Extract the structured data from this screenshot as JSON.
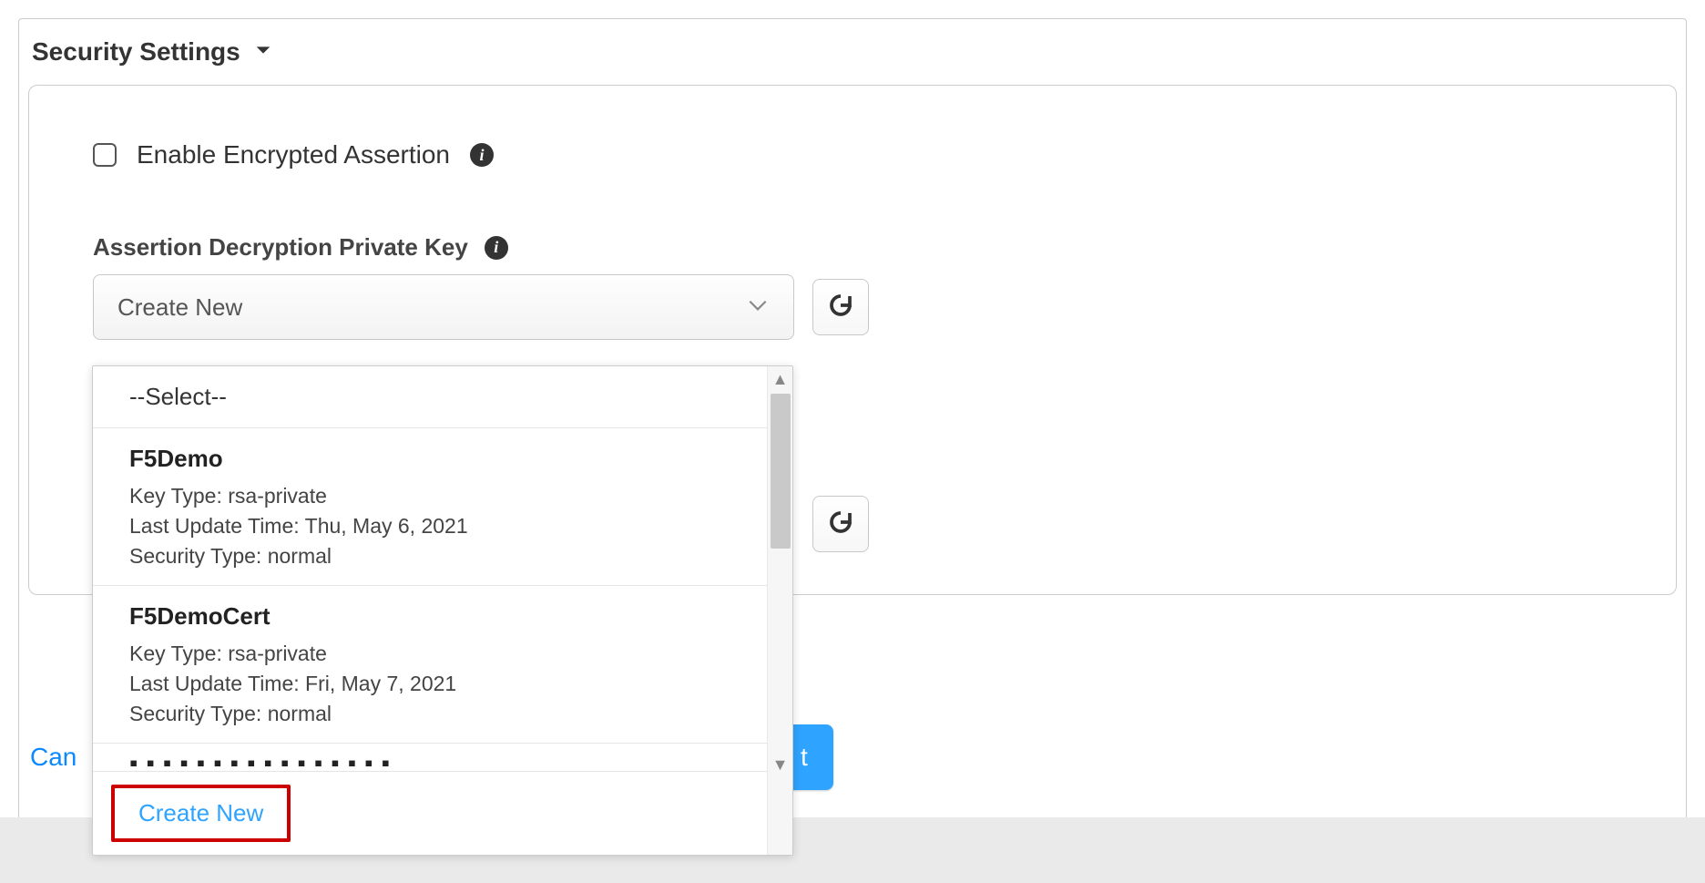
{
  "section": {
    "title": "Security Settings"
  },
  "checkbox": {
    "label": "Enable Encrypted Assertion"
  },
  "field": {
    "label": "Assertion Decryption Private Key"
  },
  "select": {
    "selected": "Create New"
  },
  "dropdown": {
    "placeholder": "--Select--",
    "items": [
      {
        "name": "F5Demo",
        "key_type_label": "Key Type:",
        "key_type": "rsa-private",
        "last_update_label": "Last Update Time:",
        "last_update": "Thu, May 6, 2021",
        "security_type_label": "Security Type:",
        "security_type": "normal"
      },
      {
        "name": "F5DemoCert",
        "key_type_label": "Key Type:",
        "key_type": "rsa-private",
        "last_update_label": "Last Update Time:",
        "last_update": "Fri, May 7, 2021",
        "security_type_label": "Security Type:",
        "security_type": "normal"
      }
    ],
    "create_new_label": "Create New"
  },
  "footer": {
    "cancel": "Can",
    "next_fragment": "t"
  }
}
